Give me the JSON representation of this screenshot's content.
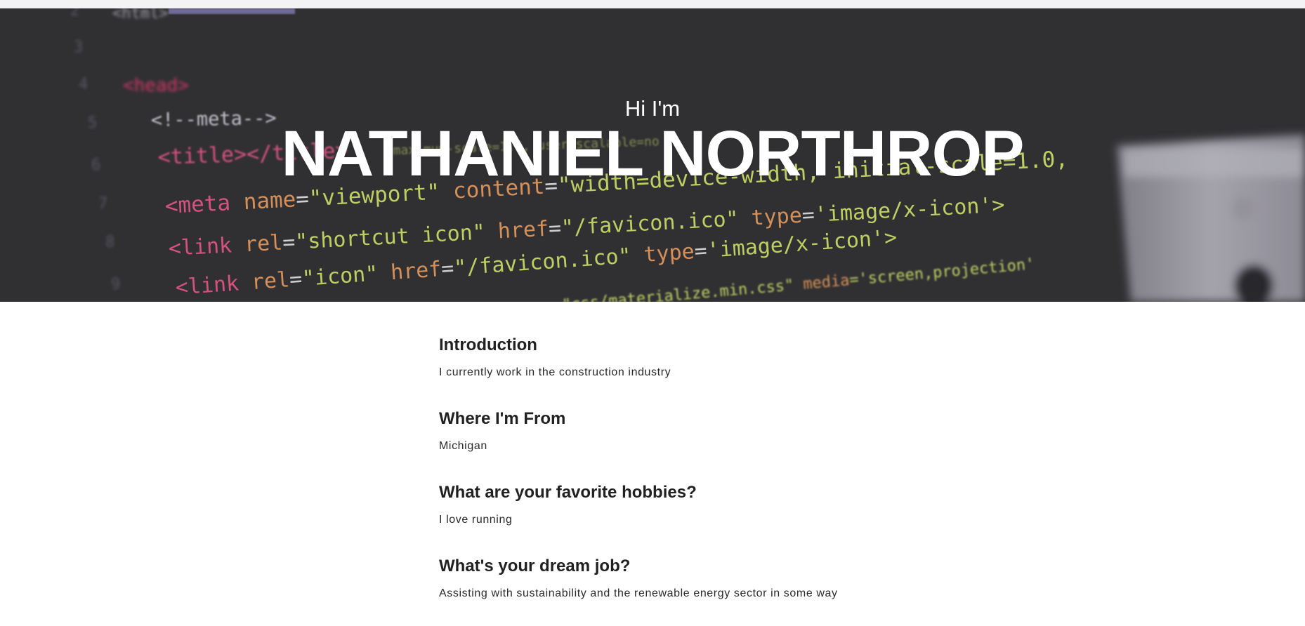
{
  "hero": {
    "subtitle": "Hi I'm",
    "title": "NATHANIEL NORTHROP",
    "background": "code-screenshot-background"
  },
  "sections": [
    {
      "heading": "Introduction",
      "body": "I currently work in the construction industry"
    },
    {
      "heading": "Where I'm From",
      "body": "Michigan"
    },
    {
      "heading": "What are your favorite hobbies?",
      "body": "I love running"
    },
    {
      "heading": "What's your dream job?",
      "body": "Assisting with sustainability and the renewable energy sector in some way"
    }
  ],
  "colors": {
    "hero_bg": "#343436",
    "hero_text": "#ffffff",
    "heading_text": "#212121",
    "body_text": "#2a2a2a"
  }
}
